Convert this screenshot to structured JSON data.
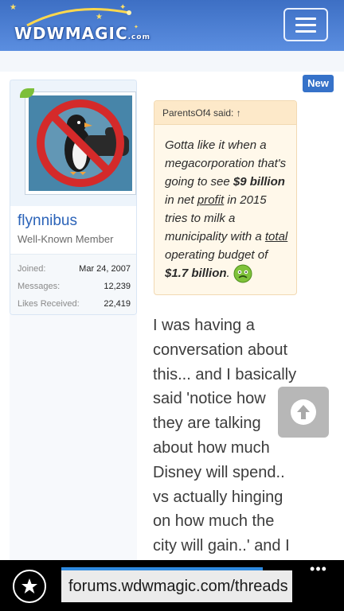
{
  "header": {
    "logo_text": "WDWMAGIC",
    "logo_domain": ".com",
    "menu_icon": "hamburger-menu-icon"
  },
  "post": {
    "new_badge": "New",
    "user": {
      "name": "flynnibus",
      "title": "Well-Known Member",
      "avatar_icon": "no-penguin-avatar-icon",
      "stats": [
        {
          "label": "Joined:",
          "value": "Mar 24, 2007"
        },
        {
          "label": "Messages:",
          "value": "12,239"
        },
        {
          "label": "Likes Received:",
          "value": "22,419"
        }
      ]
    },
    "quote": {
      "author_line": "ParentsOf4 said: ↑",
      "t1": "Gotta like it when a megacorporation that's going to see ",
      "b1": "$9 billion",
      "t2": " in net ",
      "u1": "profit",
      "t3": " in 2015 tries to milk a municipality with a ",
      "u2": "total",
      "t4": " operating budget of ",
      "b2": "$1.7 billion",
      "t5": ".",
      "emoji_icon": "sick-face-emoji-icon"
    },
    "message_text": "I was having a conversation about this... and I basically said 'notice how they are talking about how much Disney will spend.. vs actually hinging on how much the city will gain..' and I"
  },
  "scroll_top_icon": "arrow-up-icon",
  "browser": {
    "favorites_icon": "star-icon",
    "url": "forums.wdwmagic.com/threads",
    "more": "•••",
    "load_progress": 0.58
  },
  "colors": {
    "header": "#4a7ed6",
    "link": "#2b63b8",
    "badge": "#3672c9",
    "quote_bg": "#fff8ea",
    "quote_head": "#fde9c9"
  }
}
